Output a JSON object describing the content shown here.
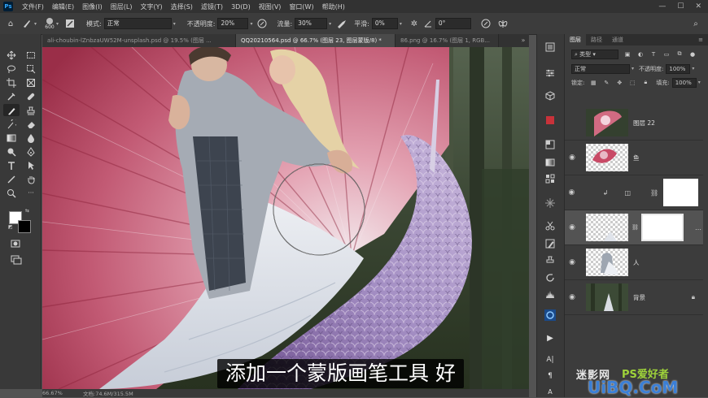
{
  "menu": {
    "logo": "Ps",
    "items": [
      "文件(F)",
      "编辑(E)",
      "图像(I)",
      "图层(L)",
      "文字(Y)",
      "选择(S)",
      "滤镜(T)",
      "3D(D)",
      "视图(V)",
      "窗口(W)",
      "帮助(H)"
    ]
  },
  "options": {
    "brush_size": "600",
    "mode_label": "模式:",
    "mode_value": "正常",
    "opacity_label": "不透明度:",
    "opacity_value": "20%",
    "flow_label": "流量:",
    "flow_value": "30%",
    "smooth_label": "平滑:",
    "smooth_value": "0%",
    "angle_value": "0°"
  },
  "tabs": [
    {
      "label": "ali-choubin-lZnbzaUW52M-unsplash.psd @ 19.5% (图层 ..."
    },
    {
      "label": "QQ20210564.psd @ 66.7% (图层 23, 图层蒙版/8) *"
    },
    {
      "label": "86.png @ 16.7% (图层 1, RGB..."
    }
  ],
  "status": {
    "zoom": "66.67%",
    "doc": "文档:74.6M/315.5M"
  },
  "subtitle": "添加一个蒙版画笔工具 好",
  "layers_panel": {
    "tabs": [
      "图层",
      "路径",
      "通道"
    ],
    "filter_label": "类型",
    "blend_mode": "正常",
    "opacity_label": "不透明度:",
    "opacity_value": "100%",
    "lock_label": "锁定:",
    "fill_label": "填充:",
    "fill_value": "100%",
    "layers": [
      {
        "name": "图层 22"
      },
      {
        "name": "鱼"
      },
      {
        "name": ""
      },
      {
        "name": ""
      },
      {
        "name": "人"
      },
      {
        "name": "背景"
      }
    ]
  },
  "watermark": {
    "line1": "迷影网",
    "line2": "UiBQ.CoM",
    "ps": "PS爱好者"
  },
  "colors": {
    "accent": "#31a8ff",
    "fg_color": "#ffffff",
    "bg_color": "#000000"
  }
}
